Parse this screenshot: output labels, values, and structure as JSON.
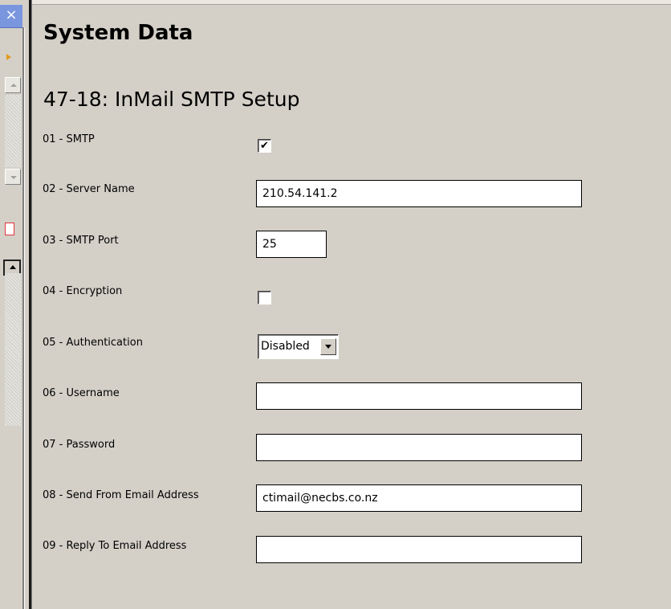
{
  "left_pane": {
    "close_glyph": "×"
  },
  "header": {
    "title": "System Data"
  },
  "section": {
    "title": "47-18: InMail SMTP Setup"
  },
  "fields": {
    "smtp": {
      "label": "01 - SMTP",
      "checked": true,
      "check_glyph": "✔"
    },
    "server_name": {
      "label": "02 - Server Name",
      "value": "210.54.141.2"
    },
    "smtp_port": {
      "label": "03 - SMTP Port",
      "value": "25"
    },
    "encryption": {
      "label": "04 - Encryption",
      "checked": false
    },
    "authentication": {
      "label": "05 - Authentication",
      "selected": "Disabled"
    },
    "username": {
      "label": "06 - Username",
      "value": ""
    },
    "password": {
      "label": "07 - Password",
      "value": ""
    },
    "send_from": {
      "label": "08 - Send From Email Address",
      "value": "ctimail@necbs.co.nz"
    },
    "reply_to": {
      "label": "09 - Reply To Email Address",
      "value": ""
    }
  },
  "icons": {
    "close": "close-icon",
    "checkmark": "checkmark-icon",
    "dropdown": "chevron-down-icon",
    "scroll_up": "scroll-up-arrow-icon",
    "scroll_down": "scroll-down-arrow-icon"
  },
  "colors": {
    "panel_background": "#d4d0c8",
    "close_button": "#7a96df",
    "accent_orange": "#e39a1b",
    "accent_red": "#e0343a"
  }
}
